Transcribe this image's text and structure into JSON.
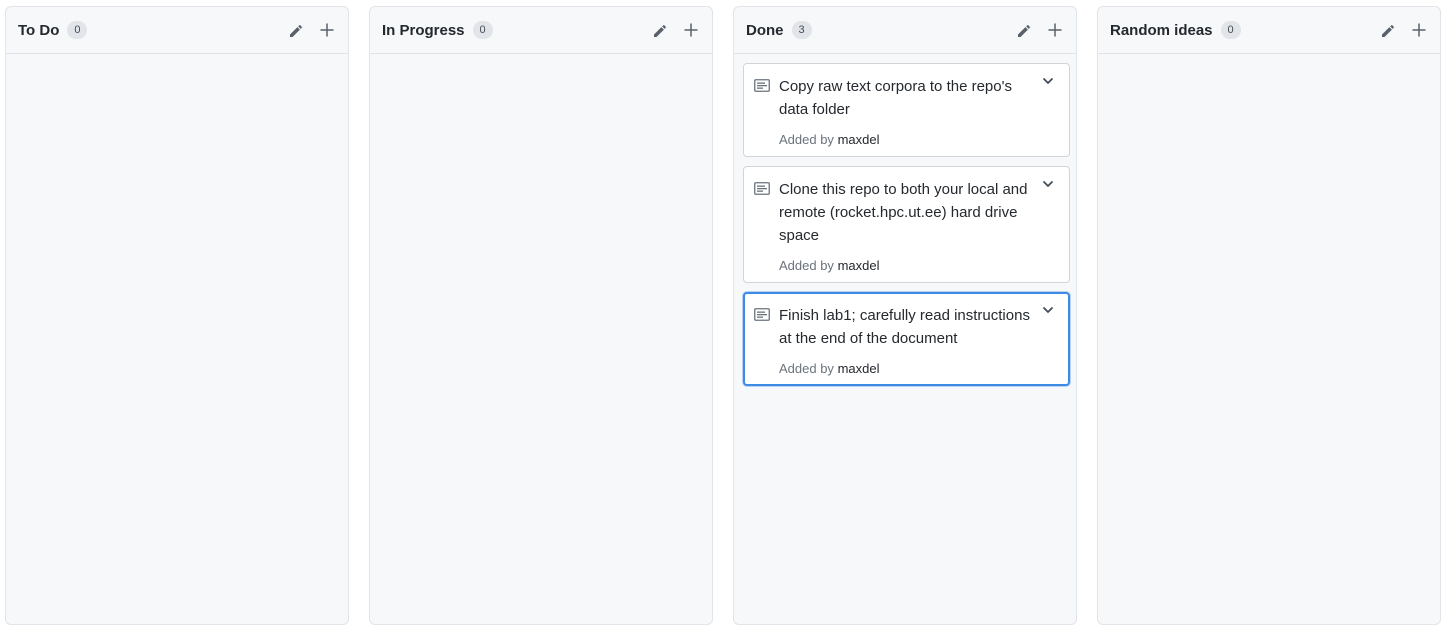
{
  "columns": [
    {
      "title": "To Do",
      "count": "0",
      "cards": []
    },
    {
      "title": "In Progress",
      "count": "0",
      "cards": []
    },
    {
      "title": "Done",
      "count": "3",
      "cards": [
        {
          "text": "Copy raw text corpora to the repo's data folder",
          "added_by_label": "Added by",
          "author": "maxdel"
        },
        {
          "text": "Clone this repo to both your local and remote (rocket.hpc.ut.ee) hard drive space",
          "added_by_label": "Added by",
          "author": "maxdel"
        },
        {
          "text": "Finish lab1; carefully read instructions at the end of the document",
          "added_by_label": "Added by",
          "author": "maxdel",
          "selected": true
        }
      ]
    },
    {
      "title": "Random ideas",
      "count": "0",
      "cards": []
    }
  ],
  "icons": {
    "edit": "pencil-icon",
    "add": "plus-icon",
    "note": "note-icon",
    "menu": "chevron-down-icon"
  },
  "colors": {
    "selected_border": "#3f8ae2",
    "column_bg": "#f6f8fa"
  }
}
